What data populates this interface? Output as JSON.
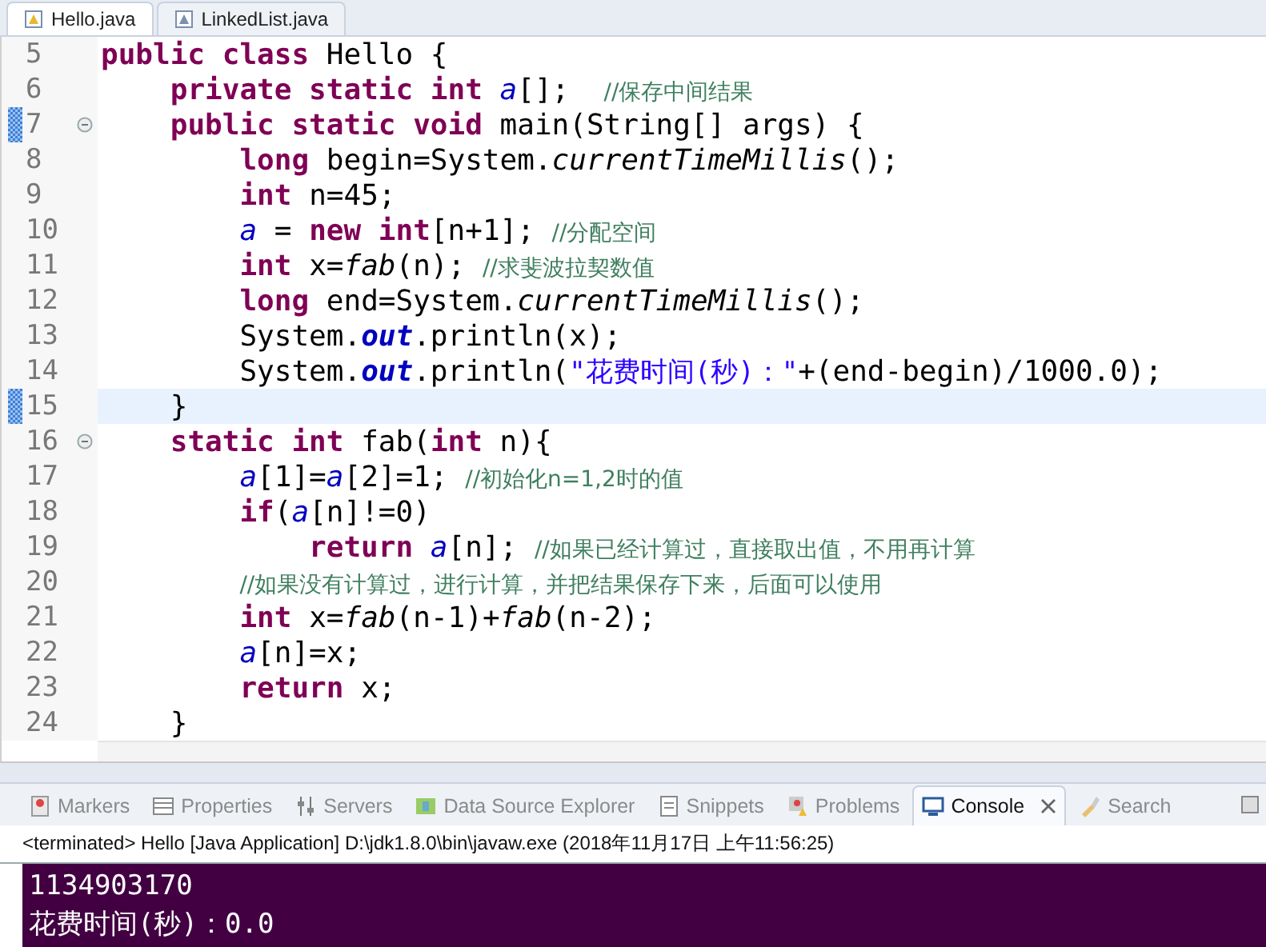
{
  "editor_tabs": [
    {
      "label": "Hello.java",
      "selected": true
    },
    {
      "label": "LinkedList.java",
      "selected": false
    }
  ],
  "code_lines": [
    {
      "number": "5",
      "fold": false,
      "current": false,
      "changed": false,
      "segments": [
        {
          "kind": "kw",
          "text": "public class "
        },
        {
          "kind": "plain",
          "text": "Hello {"
        }
      ]
    },
    {
      "number": "6",
      "fold": false,
      "current": false,
      "changed": false,
      "segments": [
        {
          "kind": "kw",
          "text": "    private static int "
        },
        {
          "kind": "field",
          "text": "a"
        },
        {
          "kind": "plain",
          "text": "[];  "
        },
        {
          "kind": "comment",
          "text": "//保存中间结果"
        }
      ]
    },
    {
      "number": "7",
      "fold": true,
      "current": false,
      "changed": true,
      "segments": [
        {
          "kind": "kw",
          "text": "    public static void "
        },
        {
          "kind": "plain",
          "text": "main(String[] args) {"
        }
      ]
    },
    {
      "number": "8",
      "fold": false,
      "current": false,
      "changed": false,
      "segments": [
        {
          "kind": "kw",
          "text": "        long "
        },
        {
          "kind": "plain",
          "text": "begin=System."
        },
        {
          "kind": "call",
          "text": "currentTimeMillis"
        },
        {
          "kind": "plain",
          "text": "();"
        }
      ]
    },
    {
      "number": "9",
      "fold": false,
      "current": false,
      "changed": false,
      "segments": [
        {
          "kind": "kw",
          "text": "        int "
        },
        {
          "kind": "plain",
          "text": "n=45;"
        }
      ]
    },
    {
      "number": "10",
      "fold": false,
      "current": false,
      "changed": false,
      "segments": [
        {
          "kind": "field",
          "text": "        a"
        },
        {
          "kind": "plain",
          "text": " = "
        },
        {
          "kind": "kw",
          "text": "new int"
        },
        {
          "kind": "plain",
          "text": "[n+1]; "
        },
        {
          "kind": "comment",
          "text": "//分配空间"
        }
      ]
    },
    {
      "number": "11",
      "fold": false,
      "current": false,
      "changed": false,
      "segments": [
        {
          "kind": "kw",
          "text": "        int "
        },
        {
          "kind": "plain",
          "text": "x="
        },
        {
          "kind": "call",
          "text": "fab"
        },
        {
          "kind": "plain",
          "text": "(n); "
        },
        {
          "kind": "comment",
          "text": "//求斐波拉契数值"
        }
      ]
    },
    {
      "number": "12",
      "fold": false,
      "current": false,
      "changed": false,
      "segments": [
        {
          "kind": "kw",
          "text": "        long "
        },
        {
          "kind": "plain",
          "text": "end=System."
        },
        {
          "kind": "call",
          "text": "currentTimeMillis"
        },
        {
          "kind": "plain",
          "text": "();"
        }
      ]
    },
    {
      "number": "13",
      "fold": false,
      "current": false,
      "changed": false,
      "segments": [
        {
          "kind": "plain",
          "text": "        System."
        },
        {
          "kind": "static",
          "text": "out"
        },
        {
          "kind": "plain",
          "text": ".println(x);"
        }
      ]
    },
    {
      "number": "14",
      "fold": false,
      "current": false,
      "changed": false,
      "segments": [
        {
          "kind": "plain",
          "text": "        System."
        },
        {
          "kind": "static",
          "text": "out"
        },
        {
          "kind": "plain",
          "text": ".println("
        },
        {
          "kind": "string",
          "text": "\"花费时间(秒)：\""
        },
        {
          "kind": "plain",
          "text": "+(end-begin)/1000.0);"
        }
      ]
    },
    {
      "number": "15",
      "fold": false,
      "current": true,
      "changed": true,
      "segments": [
        {
          "kind": "plain",
          "text": "    }"
        }
      ]
    },
    {
      "number": "16",
      "fold": true,
      "current": false,
      "changed": false,
      "segments": [
        {
          "kind": "kw",
          "text": "    static int "
        },
        {
          "kind": "plain",
          "text": "fab("
        },
        {
          "kind": "kw",
          "text": "int "
        },
        {
          "kind": "plain",
          "text": "n){"
        }
      ]
    },
    {
      "number": "17",
      "fold": false,
      "current": false,
      "changed": false,
      "segments": [
        {
          "kind": "field",
          "text": "        a"
        },
        {
          "kind": "plain",
          "text": "[1]="
        },
        {
          "kind": "field",
          "text": "a"
        },
        {
          "kind": "plain",
          "text": "[2]=1; "
        },
        {
          "kind": "comment",
          "text": "//初始化n=1,2时的值"
        }
      ]
    },
    {
      "number": "18",
      "fold": false,
      "current": false,
      "changed": false,
      "segments": [
        {
          "kind": "kw",
          "text": "        if"
        },
        {
          "kind": "plain",
          "text": "("
        },
        {
          "kind": "field",
          "text": "a"
        },
        {
          "kind": "plain",
          "text": "[n]!=0)"
        }
      ]
    },
    {
      "number": "19",
      "fold": false,
      "current": false,
      "changed": false,
      "segments": [
        {
          "kind": "kw",
          "text": "            return "
        },
        {
          "kind": "field",
          "text": "a"
        },
        {
          "kind": "plain",
          "text": "[n]; "
        },
        {
          "kind": "comment",
          "text": "//如果已经计算过，直接取出值，不用再计算"
        }
      ]
    },
    {
      "number": "20",
      "fold": false,
      "current": false,
      "changed": false,
      "segments": [
        {
          "kind": "comment",
          "text": "        //如果没有计算过，进行计算，并把结果保存下来，后面可以使用"
        }
      ]
    },
    {
      "number": "21",
      "fold": false,
      "current": false,
      "changed": false,
      "segments": [
        {
          "kind": "kw",
          "text": "        int "
        },
        {
          "kind": "plain",
          "text": "x="
        },
        {
          "kind": "call",
          "text": "fab"
        },
        {
          "kind": "plain",
          "text": "(n-1)+"
        },
        {
          "kind": "call",
          "text": "fab"
        },
        {
          "kind": "plain",
          "text": "(n-2);"
        }
      ]
    },
    {
      "number": "22",
      "fold": false,
      "current": false,
      "changed": false,
      "segments": [
        {
          "kind": "field",
          "text": "        a"
        },
        {
          "kind": "plain",
          "text": "[n]=x;"
        }
      ]
    },
    {
      "number": "23",
      "fold": false,
      "current": false,
      "changed": false,
      "segments": [
        {
          "kind": "kw",
          "text": "        return "
        },
        {
          "kind": "plain",
          "text": "x;"
        }
      ]
    },
    {
      "number": "24",
      "fold": false,
      "current": false,
      "changed": false,
      "segments": [
        {
          "kind": "plain",
          "text": "    }"
        }
      ]
    }
  ],
  "panel_tabs": [
    {
      "label": "Markers",
      "selected": false
    },
    {
      "label": "Properties",
      "selected": false
    },
    {
      "label": "Servers",
      "selected": false
    },
    {
      "label": "Data Source Explorer",
      "selected": false
    },
    {
      "label": "Snippets",
      "selected": false
    },
    {
      "label": "Problems",
      "selected": false
    },
    {
      "label": "Console",
      "selected": true
    },
    {
      "label": "Search",
      "selected": false
    }
  ],
  "console": {
    "status": "<terminated> Hello [Java Application] D:\\jdk1.8.0\\bin\\javaw.exe (2018年11月17日 上午11:56:25)",
    "output": [
      "1134903170",
      "花费时间(秒)：0.0"
    ]
  }
}
